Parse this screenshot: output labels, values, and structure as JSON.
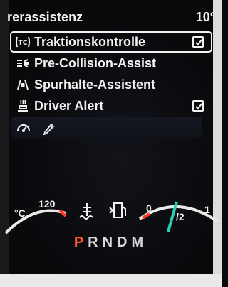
{
  "header": {
    "title": "rerassistenz",
    "temp": "10°"
  },
  "assist_menu": {
    "items": [
      {
        "label": "Traktionskontrolle",
        "icon": "traction-control-icon",
        "checked": true,
        "selected": true
      },
      {
        "label": "Pre-Collision-Assist",
        "icon": "pre-collision-icon",
        "checked": false,
        "selected": false
      },
      {
        "label": "Spurhalte-Assistent",
        "icon": "lane-keeping-icon",
        "checked": false,
        "selected": false
      },
      {
        "label": "Driver Alert",
        "icon": "driver-alert-icon",
        "checked": true,
        "selected": false
      }
    ],
    "tools_icons": [
      "speed-limit-icon",
      "pen-icon"
    ]
  },
  "gauges": {
    "temp_unit": "°C",
    "temp_max": "120",
    "fuel_zero": "0",
    "fuel_half": "/2",
    "fuel_full": "1"
  },
  "gear": {
    "active": "P",
    "rest": "RNDM"
  },
  "colors": {
    "accent_red": "#ff3b1f",
    "accent_teal": "#26d3b5",
    "text": "#f2f2f2"
  }
}
